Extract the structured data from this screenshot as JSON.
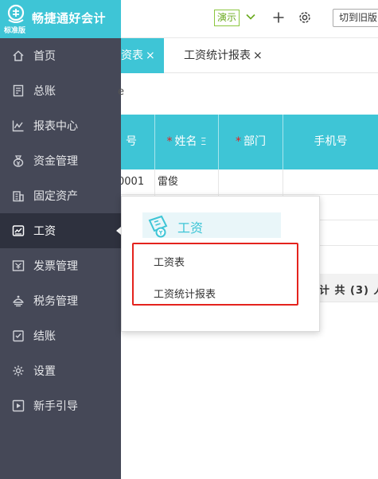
{
  "brand": {
    "name": "畅捷通好会计",
    "edition": "标准版",
    "color": "#3ec5d6"
  },
  "sidebar": {
    "items": [
      {
        "label": "首页",
        "icon": "home-icon"
      },
      {
        "label": "总账",
        "icon": "ledger-icon"
      },
      {
        "label": "报表中心",
        "icon": "chart-line-icon"
      },
      {
        "label": "资金管理",
        "icon": "money-bag-icon"
      },
      {
        "label": "固定资产",
        "icon": "building-icon"
      },
      {
        "label": "工资",
        "icon": "salary-icon",
        "active": true
      },
      {
        "label": "发票管理",
        "icon": "invoice-icon"
      },
      {
        "label": "税务管理",
        "icon": "tax-icon"
      },
      {
        "label": "结账",
        "icon": "checkout-icon"
      },
      {
        "label": "设置",
        "icon": "gear-icon"
      },
      {
        "label": "新手引导",
        "icon": "play-icon"
      }
    ]
  },
  "topbar": {
    "demo_label": "演示",
    "switch_label": "切到旧版"
  },
  "tabs": [
    {
      "label": "资表",
      "close": "×"
    },
    {
      "label": "工资统计报表",
      "close": "×"
    }
  ],
  "content": {
    "crumb_fragment": "e",
    "columns": [
      {
        "label": "号",
        "required": false
      },
      {
        "label": "姓名",
        "required": true,
        "suffix": "Ξ"
      },
      {
        "label": "部门",
        "required": true
      },
      {
        "label": "手机号",
        "required": false
      }
    ],
    "rows": [
      {
        "id": "0001",
        "name": "雷俊",
        "dept": "",
        "phone": ""
      },
      {
        "id": "",
        "name": "",
        "dept": "",
        "phone": ""
      },
      {
        "id": "",
        "name": "",
        "dept": "",
        "phone": ""
      }
    ],
    "summary": "计 共 (3) 人"
  },
  "popup": {
    "title": "工资",
    "links": [
      "工资表",
      "工资统计报表"
    ]
  }
}
